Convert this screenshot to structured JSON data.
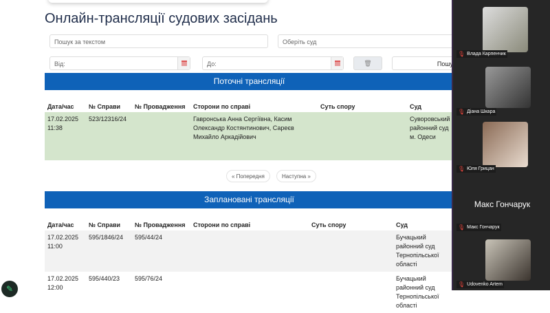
{
  "title": "Онлайн-трансляції судових засідань",
  "filters": {
    "search_placeholder": "Пошук за текстом",
    "court_placeholder": "Оберіть суд",
    "from_placeholder": "Від:",
    "to_placeholder": "До:",
    "search_button": "Пошук"
  },
  "current": {
    "title": "Поточні трансляції",
    "headers": [
      "Дата/час",
      "№ Справи",
      "№ Провадження",
      "Сторони по справі",
      "Суть спору",
      "Суд"
    ],
    "rows": [
      {
        "date": "17.02.2025",
        "time": "11:38",
        "case": "523/12316/24",
        "proc": "",
        "parties": "Гавронська Анна Сергіївна, Касим Олександр Костянтинович, Сареєв Михайло Аркадійович",
        "subject": "",
        "court": "Суворовський районний суд м. Одеси"
      }
    ]
  },
  "pagination": {
    "prev": "« Попередня",
    "next": "Наступна »"
  },
  "scheduled": {
    "title": "Заплановані трансляції",
    "headers": [
      "Дата/час",
      "№ Справи",
      "№ Провадження",
      "Сторони по справі",
      "Суть спору",
      "Суд"
    ],
    "rows": [
      {
        "date": "17.02.2025",
        "time": "11:00",
        "case": "595/1846/24",
        "proc": "595/44/24",
        "parties": "",
        "subject": "",
        "court": "Бучацький районний суд Тернопільської області"
      },
      {
        "date": "17.02.2025",
        "time": "12:00",
        "case": "595/440/23",
        "proc": "595/76/24",
        "parties": "",
        "subject": "",
        "court": "Бучацький районний суд Тернопільської області"
      }
    ]
  },
  "participants": [
    {
      "name": "Влада Карпенчик"
    },
    {
      "name": "Діана Шкара"
    },
    {
      "name": "Юля Грицан"
    },
    {
      "name": "Макс Гончарук",
      "big": "Макс Гончарук"
    },
    {
      "name": "Udovenko Artem"
    }
  ],
  "fab_icon": "✎"
}
